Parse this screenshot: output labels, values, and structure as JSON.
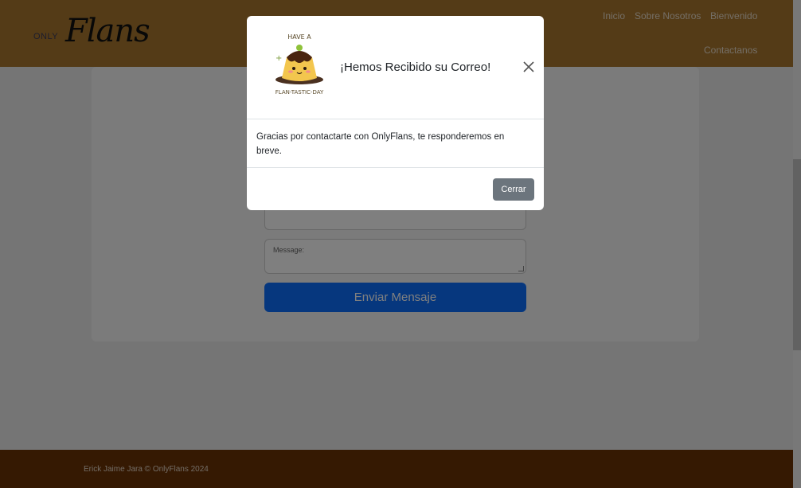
{
  "navbar": {
    "logo_small": "ONLY",
    "logo_big": "Flans",
    "links": [
      "Inicio",
      "Sobre Nosotros",
      "Bienvenido",
      "Contactanos"
    ]
  },
  "form": {
    "message_label": "Message:",
    "send_button": "Enviar Mensaje"
  },
  "footer": {
    "text": "Erick Jaime Jara © OnlyFlans 2024"
  },
  "modal": {
    "image_caption_top": "HAVE A",
    "image_caption_bottom": "FLAN-TASTIC-DAY",
    "title": "¡Hemos Recibido su Correo!",
    "body": "Gracias por contactarte con OnlyFlans, te responderemos en breve.",
    "close_button": "Cerrar"
  },
  "colors": {
    "navbar": "#a8772f",
    "footer": "#6b3305",
    "primary_button": "#0d6efd",
    "secondary_button": "#6c757d"
  }
}
